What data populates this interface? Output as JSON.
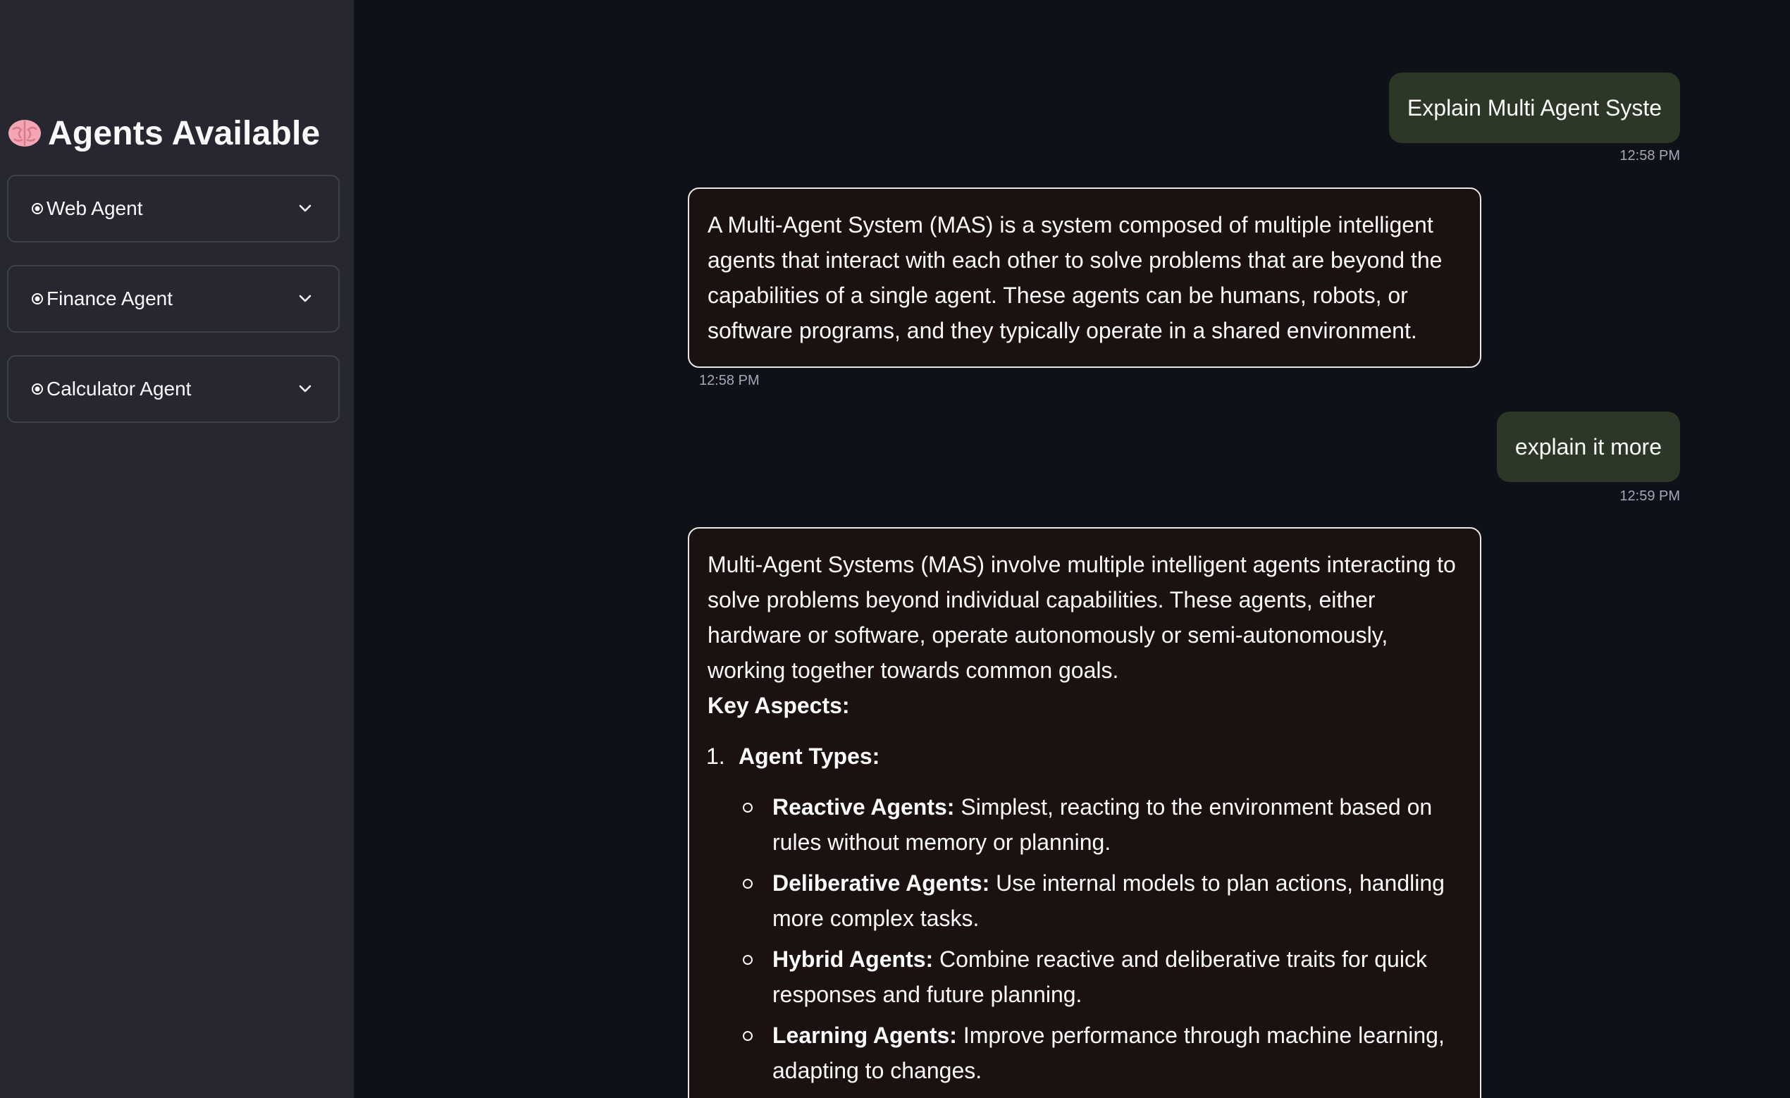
{
  "sidebar": {
    "title": "Agents Available",
    "title_icon": "brain-icon",
    "agents": [
      {
        "label": "Web Agent",
        "icon": "dot-icon"
      },
      {
        "label": "Finance Agent",
        "icon": "dot-icon"
      },
      {
        "label": "Calculator Agent",
        "icon": "dot-icon"
      }
    ]
  },
  "chat": {
    "messages": [
      {
        "role": "user",
        "text": "Explain Multi Agent Syste",
        "time": "12:58 PM"
      },
      {
        "role": "assistant",
        "text": "A Multi-Agent System (MAS) is a system composed of multiple intelligent agents that interact with each other to solve problems that are beyond the capabilities of a single agent. These agents can be humans, robots, or software programs, and they typically operate in a shared environment.",
        "time": "12:58 PM"
      },
      {
        "role": "user",
        "text": "explain it more",
        "time": "12:59 PM"
      },
      {
        "role": "assistant",
        "intro": "Multi-Agent Systems (MAS) involve multiple intelligent agents interacting to solve problems beyond individual capabilities. These agents, either hardware or software, operate autonomously or semi-autonomously, working together towards common goals.",
        "heading": "Key Aspects:",
        "list_number": "1.",
        "list_title": "Agent Types:",
        "items": [
          {
            "term": "Reactive Agents:",
            "desc": " Simplest, reacting to the environment based on rules without memory or planning."
          },
          {
            "term": "Deliberative Agents:",
            "desc": " Use internal models to plan actions, handling more complex tasks."
          },
          {
            "term": "Hybrid Agents:",
            "desc": " Combine reactive and deliberative traits for quick responses and future planning."
          },
          {
            "term": "Learning Agents:",
            "desc": " Improve performance through machine learning, adapting to changes."
          }
        ]
      }
    ]
  },
  "colors": {
    "sidebar_bg": "#262730",
    "main_bg": "#0e1117",
    "user_bubble": "#2c3727",
    "bot_bubble": "#1c1111"
  }
}
